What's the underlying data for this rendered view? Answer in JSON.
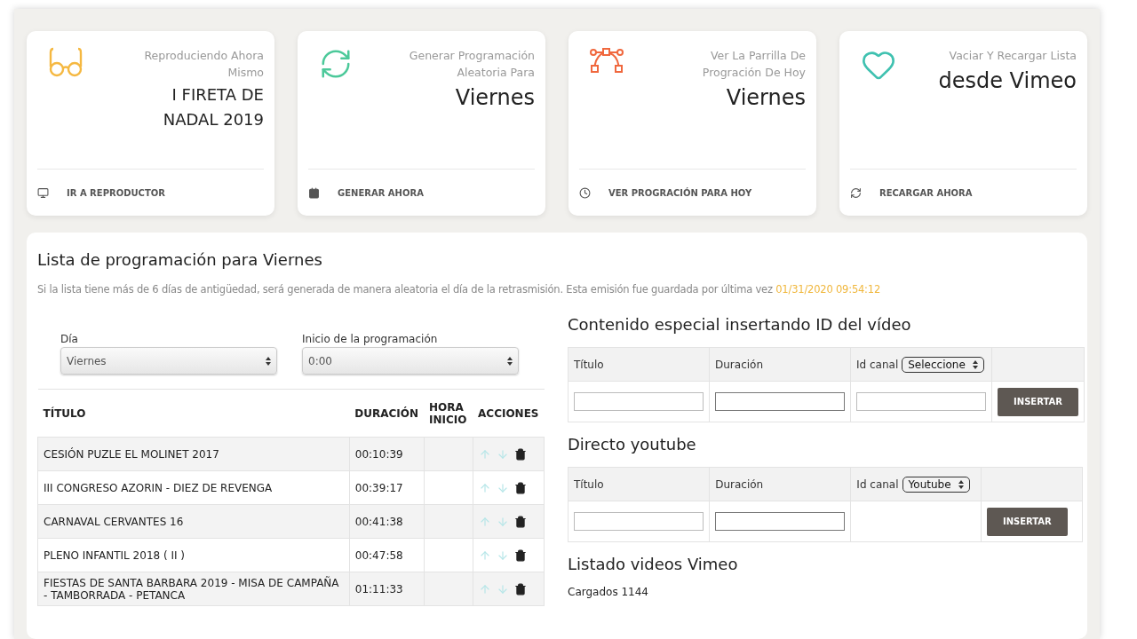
{
  "cards": [
    {
      "subtitle": "Reproduciendo Ahora Mismo",
      "title": "I FIRETA DE NADAL 2019",
      "action": "IR A REPRODUCTOR",
      "color": "#f5b841"
    },
    {
      "subtitle": "Generar Programación Aleatoria Para",
      "title": "Viernes",
      "action": "GENERAR AHORA",
      "color": "#4cc99a"
    },
    {
      "subtitle": "Ver La Parrilla De Progración De Hoy",
      "title": "Viernes",
      "action": "VER PROGRACIÓN PARA HOY",
      "color": "#f0683e"
    },
    {
      "subtitle": "Vaciar Y Recargar Lista",
      "title": "desde Vimeo",
      "action": "RECARGAR AHORA",
      "color": "#3fc1b0"
    }
  ],
  "panel": {
    "title": "Lista de programación para Viernes",
    "note": "Si la lista tiene más de 6 días de antigüedad, será generada de manera aleatoria el día de la retrasmisión. Esta emisión fue guardada por última vez",
    "saved_at": "01/31/2020 09:54:12",
    "filters": [
      {
        "label": "Día",
        "value": "Viernes"
      },
      {
        "label": "Inicio de la programación",
        "value": "0:00"
      }
    ],
    "table": {
      "columns": [
        "TÍTULO",
        "DURACIÓN",
        "HORA INICIO",
        "ACCIONES"
      ],
      "rows": [
        {
          "title": "CESIÓN PUZLE EL MOLINET 2017",
          "duration": "00:10:39"
        },
        {
          "title": "III CONGRESO AZORIN - DIEZ DE REVENGA",
          "duration": "00:39:17"
        },
        {
          "title": "CARNAVAL CERVANTES 16",
          "duration": "00:41:38"
        },
        {
          "title": "PLENO INFANTIL 2018 ( II )",
          "duration": "00:47:58"
        },
        {
          "title": "FIESTAS DE SANTA BARBARA 2019 - MISA DE CAMPAÑA - TAMBORRADA - PETANCA",
          "duration": "01:11:33"
        }
      ]
    },
    "sections": [
      {
        "title": "Contenido especial insertando ID del vídeo",
        "columns": [
          "Título",
          "Duración",
          "Id canal"
        ],
        "channel_select": "Seleccione",
        "channel_field": true,
        "button": "INSERTAR"
      },
      {
        "title": "Directo youtube",
        "columns": [
          "Título",
          "Duración",
          "Id canal"
        ],
        "channel_select": "Youtube",
        "channel_field": false,
        "button": "INSERTAR"
      }
    ],
    "vimeo": {
      "title": "Listado videos Vimeo",
      "count": "Cargados 1144"
    }
  }
}
